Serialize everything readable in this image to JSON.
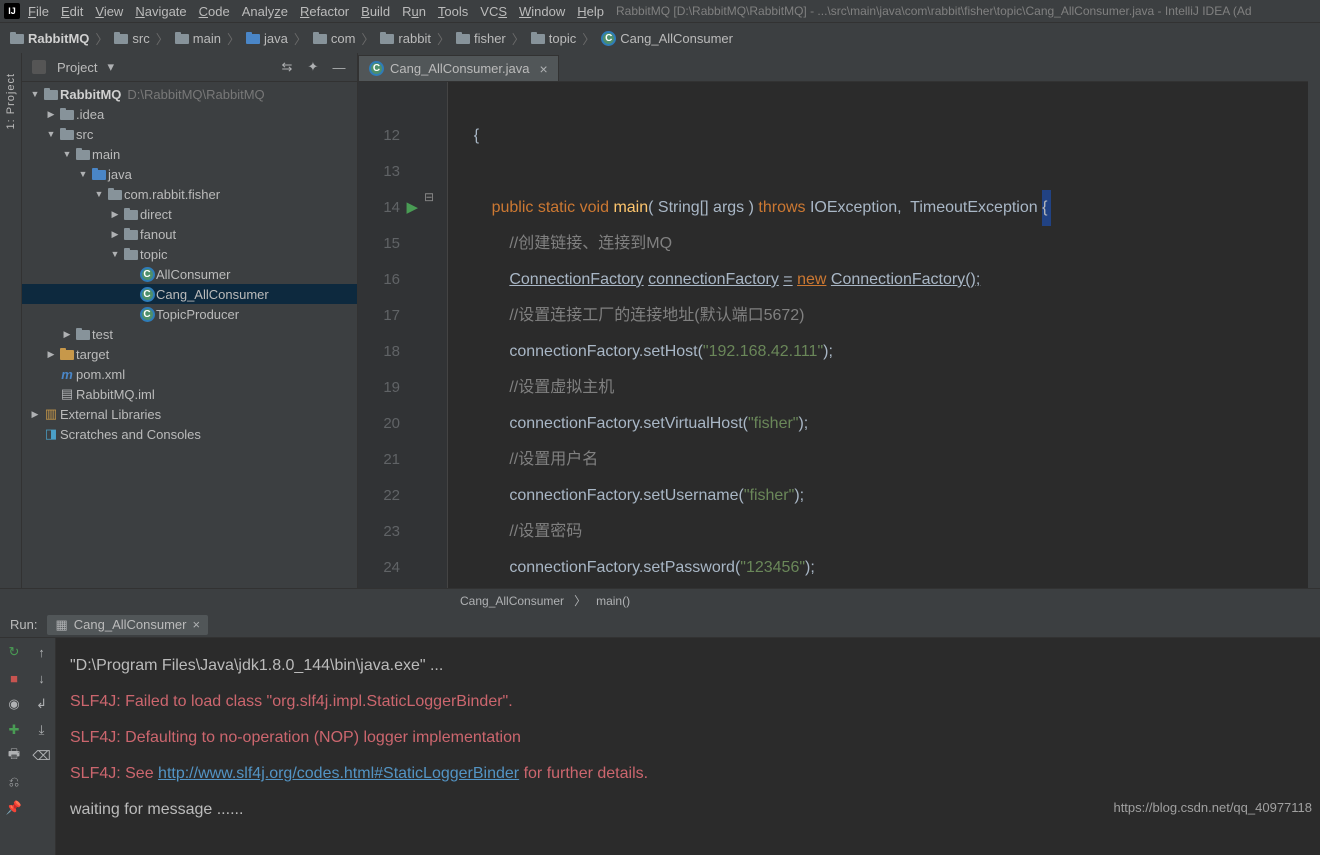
{
  "app_icon_text": "IJ",
  "menu": [
    "File",
    "Edit",
    "View",
    "Navigate",
    "Code",
    "Analyze",
    "Refactor",
    "Build",
    "Run",
    "Tools",
    "VCS",
    "Window",
    "Help"
  ],
  "title_text": "RabbitMQ [D:\\RabbitMQ\\RabbitMQ] - ...\\src\\main\\java\\com\\rabbit\\fisher\\topic\\Cang_AllConsumer.java - IntelliJ IDEA (Ad",
  "breadcrumb": [
    "RabbitMQ",
    "src",
    "main",
    "java",
    "com",
    "rabbit",
    "fisher",
    "topic",
    "Cang_AllConsumer"
  ],
  "left_strip_label": "1: Project",
  "pane_title": "Project",
  "tree": {
    "root_name": "RabbitMQ",
    "root_path": "D:\\RabbitMQ\\RabbitMQ",
    "idea": ".idea",
    "src": "src",
    "main": "main",
    "java": "java",
    "package": "com.rabbit.fisher",
    "direct": "direct",
    "fanout": "fanout",
    "topic": "topic",
    "all_consumer": "AllConsumer",
    "cang_all": "Cang_AllConsumer",
    "topic_producer": "TopicProducer",
    "test": "test",
    "target": "target",
    "pom": "pom.xml",
    "iml": "RabbitMQ.iml",
    "ext_lib": "External Libraries",
    "scratches": "Scratches and Consoles"
  },
  "tab": {
    "name": "Cang_AllConsumer.java"
  },
  "gutter_lines": [
    "",
    "12",
    "",
    "13",
    "",
    "14",
    "",
    "15",
    "",
    "16",
    "",
    "17",
    "",
    "18",
    "",
    "19",
    "",
    "20",
    "",
    "21",
    "",
    "22",
    "",
    "23",
    "",
    "24"
  ],
  "code": {
    "l12": "{",
    "l14_public": "public",
    "l14_static": "static",
    "l14_void": "void",
    "l14_main": "main",
    "l14_string": "String",
    "l14_args": "args",
    "l14_throws": "throws",
    "l14_ioe": "IOException",
    "l14_toe": "TimeoutException",
    "l15_cmnt": "//创建链接、连接到MQ",
    "l16_cf": "ConnectionFactory",
    "l16_var": "connectionFactory",
    "l16_new": "new",
    "l16_cf2": "ConnectionFactory",
    "l17_cmnt": "//设置连接工厂的连接地址(默认端口5672)",
    "l18_var": "connectionFactory",
    "l18_m": "setHost",
    "l18_s": "\"192.168.42.111\"",
    "l19_cmnt": "//设置虚拟主机",
    "l20_var": "connectionFactory",
    "l20_m": "setVirtualHost",
    "l20_s": "\"fisher\"",
    "l21_cmnt": "//设置用户名",
    "l22_var": "connectionFactory",
    "l22_m": "setUsername",
    "l22_s": "\"fisher\"",
    "l23_cmnt": "//设置密码",
    "l24_var": "connectionFactory",
    "l24_m": "setPassword",
    "l24_s": "\"123456\""
  },
  "status_path": {
    "cls": "Cang_AllConsumer",
    "mth": "main()"
  },
  "run": {
    "label": "Run:",
    "config": "Cang_AllConsumer",
    "line1": "\"D:\\Program Files\\Java\\jdk1.8.0_144\\bin\\java.exe\" ...",
    "line2": "SLF4J: Failed to load class \"org.slf4j.impl.StaticLoggerBinder\".",
    "line3": "SLF4J: Defaulting to no-operation (NOP) logger implementation",
    "line4a": "SLF4J: See ",
    "line4_link": "http://www.slf4j.org/codes.html#StaticLoggerBinder",
    "line4b": " for further details.",
    "line5": "waiting for message ......"
  },
  "watermark": "https://blog.csdn.net/qq_40977118"
}
